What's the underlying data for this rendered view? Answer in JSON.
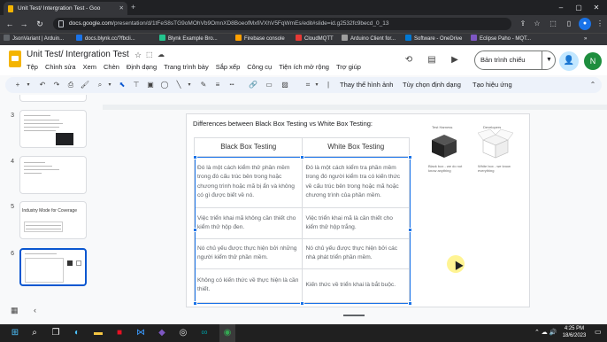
{
  "browser": {
    "tab_title": "Unit Test/ Intergration Test - Goo",
    "new_tab": "+",
    "url_host": "docs.google.com",
    "url_path": "/presentation/d/1tFeS8sTG9oMOhVb9OmnXD8BoeofMxfiVXhV5FqWmEs/edit#slide=id.g2532fc9becd_0_13",
    "win_min": "–",
    "win_max": "▢",
    "win_close": "✕",
    "bookmarks": [
      {
        "label": "JsonVariant | Arduin...",
        "color": "#5f6368"
      },
      {
        "label": "docs.blynk.cc/?fbcli...",
        "color": "#1a73e8"
      },
      {
        "label": "Blynk Example Bro...",
        "color": "#23c48e"
      },
      {
        "label": "Firebase console",
        "color": "#ffa000"
      },
      {
        "label": "CloudMQTT",
        "color": "#e53935"
      },
      {
        "label": "Arduino Client for...",
        "color": "#9e9e9e"
      },
      {
        "label": "Software - OneDrive",
        "color": "#0078d4"
      },
      {
        "label": "Eclipse Paho - MQT...",
        "color": "#7e57c2"
      }
    ]
  },
  "docs": {
    "title": "Unit Test/ Intergration Test",
    "menus": [
      "Tệp",
      "Chỉnh sửa",
      "Xem",
      "Chèn",
      "Định dạng",
      "Trang trình bày",
      "Sắp xếp",
      "Công cụ",
      "Tiện ích mở rộng",
      "Trợ giúp"
    ],
    "present_label": "Bản trình chiếu",
    "avatar_letter": "N",
    "toolbar_text": [
      "Thay thế hình ảnh",
      "Tùy chọn định dạng",
      "Tạo hiệu ứng"
    ]
  },
  "slides_panel": {
    "numbers": [
      "3",
      "4",
      "5",
      "6"
    ],
    "slide5_title": "Industry Mode for Coverage"
  },
  "slide": {
    "title": "Differences between Black Box Testing vs White Box Testing:",
    "col_black": "Black Box Testing",
    "col_white": "White Box Testing",
    "rows": [
      [
        "Đó là một cách kiểm thử phần mềm trong đó cấu trúc bên trong hoặc chương trình hoặc mã bị ẩn và không có gì được biết về nó.",
        "Đó là một cách kiểm tra phần mềm trong đó người kiểm tra có kiến thức về cấu trúc bên trong hoặc mã hoặc chương trình của phần mềm."
      ],
      [
        "Việc triển khai mã không cần thiết cho kiểm thử hộp đen.",
        "Việc triển khai mã là cần thiết cho kiểm thử hộp trắng."
      ],
      [
        "Nó chủ yếu được thực hiện bởi những người kiểm thử phần mềm.",
        "Nó chủ yếu được thực hiện bởi các nhà phát triển phần mềm."
      ],
      [
        "Không có kiến thức về thực hiện là cần thiết.",
        "Kiến thức về triển khai là bắt buộc."
      ]
    ],
    "illus_top_left": "Test Harness",
    "illus_top_right": "Developers",
    "illus_black_caption": "Black box - we do not know anything",
    "illus_white_caption": "White box - we know everything"
  },
  "taskbar": {
    "time": "4:25 PM",
    "date": "18/6/2023"
  }
}
